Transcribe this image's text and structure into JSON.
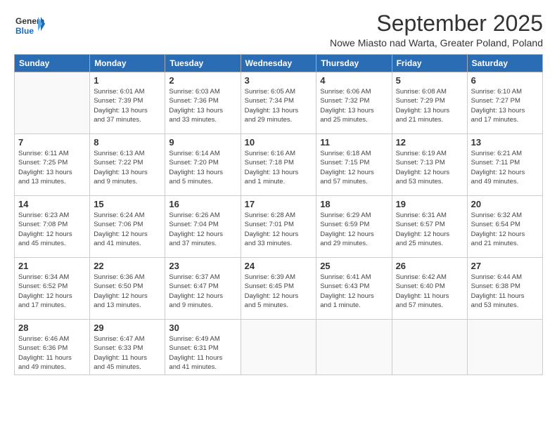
{
  "logo": {
    "general": "General",
    "blue": "Blue"
  },
  "title": "September 2025",
  "location": "Nowe Miasto nad Warta, Greater Poland, Poland",
  "days_header": [
    "Sunday",
    "Monday",
    "Tuesday",
    "Wednesday",
    "Thursday",
    "Friday",
    "Saturday"
  ],
  "weeks": [
    [
      {
        "day": "",
        "info": ""
      },
      {
        "day": "1",
        "info": "Sunrise: 6:01 AM\nSunset: 7:39 PM\nDaylight: 13 hours\nand 37 minutes."
      },
      {
        "day": "2",
        "info": "Sunrise: 6:03 AM\nSunset: 7:36 PM\nDaylight: 13 hours\nand 33 minutes."
      },
      {
        "day": "3",
        "info": "Sunrise: 6:05 AM\nSunset: 7:34 PM\nDaylight: 13 hours\nand 29 minutes."
      },
      {
        "day": "4",
        "info": "Sunrise: 6:06 AM\nSunset: 7:32 PM\nDaylight: 13 hours\nand 25 minutes."
      },
      {
        "day": "5",
        "info": "Sunrise: 6:08 AM\nSunset: 7:29 PM\nDaylight: 13 hours\nand 21 minutes."
      },
      {
        "day": "6",
        "info": "Sunrise: 6:10 AM\nSunset: 7:27 PM\nDaylight: 13 hours\nand 17 minutes."
      }
    ],
    [
      {
        "day": "7",
        "info": "Sunrise: 6:11 AM\nSunset: 7:25 PM\nDaylight: 13 hours\nand 13 minutes."
      },
      {
        "day": "8",
        "info": "Sunrise: 6:13 AM\nSunset: 7:22 PM\nDaylight: 13 hours\nand 9 minutes."
      },
      {
        "day": "9",
        "info": "Sunrise: 6:14 AM\nSunset: 7:20 PM\nDaylight: 13 hours\nand 5 minutes."
      },
      {
        "day": "10",
        "info": "Sunrise: 6:16 AM\nSunset: 7:18 PM\nDaylight: 13 hours\nand 1 minute."
      },
      {
        "day": "11",
        "info": "Sunrise: 6:18 AM\nSunset: 7:15 PM\nDaylight: 12 hours\nand 57 minutes."
      },
      {
        "day": "12",
        "info": "Sunrise: 6:19 AM\nSunset: 7:13 PM\nDaylight: 12 hours\nand 53 minutes."
      },
      {
        "day": "13",
        "info": "Sunrise: 6:21 AM\nSunset: 7:11 PM\nDaylight: 12 hours\nand 49 minutes."
      }
    ],
    [
      {
        "day": "14",
        "info": "Sunrise: 6:23 AM\nSunset: 7:08 PM\nDaylight: 12 hours\nand 45 minutes."
      },
      {
        "day": "15",
        "info": "Sunrise: 6:24 AM\nSunset: 7:06 PM\nDaylight: 12 hours\nand 41 minutes."
      },
      {
        "day": "16",
        "info": "Sunrise: 6:26 AM\nSunset: 7:04 PM\nDaylight: 12 hours\nand 37 minutes."
      },
      {
        "day": "17",
        "info": "Sunrise: 6:28 AM\nSunset: 7:01 PM\nDaylight: 12 hours\nand 33 minutes."
      },
      {
        "day": "18",
        "info": "Sunrise: 6:29 AM\nSunset: 6:59 PM\nDaylight: 12 hours\nand 29 minutes."
      },
      {
        "day": "19",
        "info": "Sunrise: 6:31 AM\nSunset: 6:57 PM\nDaylight: 12 hours\nand 25 minutes."
      },
      {
        "day": "20",
        "info": "Sunrise: 6:32 AM\nSunset: 6:54 PM\nDaylight: 12 hours\nand 21 minutes."
      }
    ],
    [
      {
        "day": "21",
        "info": "Sunrise: 6:34 AM\nSunset: 6:52 PM\nDaylight: 12 hours\nand 17 minutes."
      },
      {
        "day": "22",
        "info": "Sunrise: 6:36 AM\nSunset: 6:50 PM\nDaylight: 12 hours\nand 13 minutes."
      },
      {
        "day": "23",
        "info": "Sunrise: 6:37 AM\nSunset: 6:47 PM\nDaylight: 12 hours\nand 9 minutes."
      },
      {
        "day": "24",
        "info": "Sunrise: 6:39 AM\nSunset: 6:45 PM\nDaylight: 12 hours\nand 5 minutes."
      },
      {
        "day": "25",
        "info": "Sunrise: 6:41 AM\nSunset: 6:43 PM\nDaylight: 12 hours\nand 1 minute."
      },
      {
        "day": "26",
        "info": "Sunrise: 6:42 AM\nSunset: 6:40 PM\nDaylight: 11 hours\nand 57 minutes."
      },
      {
        "day": "27",
        "info": "Sunrise: 6:44 AM\nSunset: 6:38 PM\nDaylight: 11 hours\nand 53 minutes."
      }
    ],
    [
      {
        "day": "28",
        "info": "Sunrise: 6:46 AM\nSunset: 6:36 PM\nDaylight: 11 hours\nand 49 minutes."
      },
      {
        "day": "29",
        "info": "Sunrise: 6:47 AM\nSunset: 6:33 PM\nDaylight: 11 hours\nand 45 minutes."
      },
      {
        "day": "30",
        "info": "Sunrise: 6:49 AM\nSunset: 6:31 PM\nDaylight: 11 hours\nand 41 minutes."
      },
      {
        "day": "",
        "info": ""
      },
      {
        "day": "",
        "info": ""
      },
      {
        "day": "",
        "info": ""
      },
      {
        "day": "",
        "info": ""
      }
    ]
  ]
}
